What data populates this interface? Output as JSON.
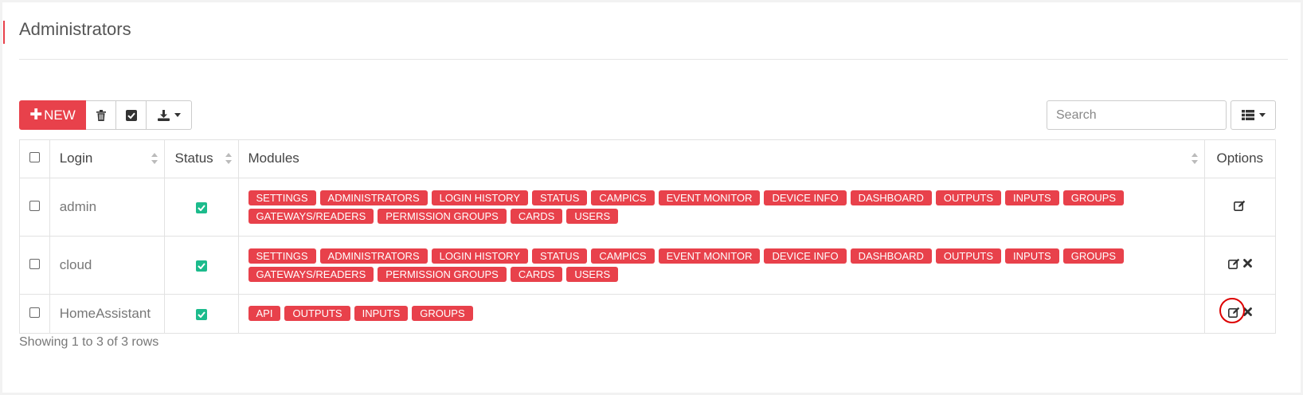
{
  "page": {
    "title": "Administrators"
  },
  "toolbar": {
    "new_label": "NEW",
    "search_placeholder": "Search"
  },
  "table": {
    "columns": [
      "Login",
      "Status",
      "Modules",
      "Options"
    ],
    "rows": [
      {
        "login": "admin",
        "status": "checked",
        "modules": [
          "SETTINGS",
          "ADMINISTRATORS",
          "LOGIN HISTORY",
          "STATUS",
          "CAMPICS",
          "EVENT MONITOR",
          "DEVICE INFO",
          "DASHBOARD",
          "OUTPUTS",
          "INPUTS",
          "GROUPS",
          "GATEWAYS/READERS",
          "PERMISSION GROUPS",
          "CARDS",
          "USERS"
        ],
        "options": [
          "edit-icon"
        ]
      },
      {
        "login": "cloud",
        "status": "checked",
        "modules": [
          "SETTINGS",
          "ADMINISTRATORS",
          "LOGIN HISTORY",
          "STATUS",
          "CAMPICS",
          "EVENT MONITOR",
          "DEVICE INFO",
          "DASHBOARD",
          "OUTPUTS",
          "INPUTS",
          "GROUPS",
          "GATEWAYS/READERS",
          "PERMISSION GROUPS",
          "CARDS",
          "USERS"
        ],
        "options": [
          "edit-icon",
          "delete-icon"
        ]
      },
      {
        "login": "HomeAssistant",
        "status": "checked",
        "modules": [
          "API",
          "OUTPUTS",
          "INPUTS",
          "GROUPS"
        ],
        "options": [
          "edit-icon",
          "delete-icon"
        ]
      }
    ]
  },
  "pagination": {
    "summary": "Showing 1 to 3 of 3 rows"
  },
  "colors": {
    "accent": "#e8414b",
    "status_ok": "#1cbb8c",
    "highlight_ring": "#dd0000"
  },
  "icons": [
    "plus-icon",
    "trash-icon",
    "check-square-icon",
    "download-icon",
    "caret-down-icon",
    "list-view-icon",
    "edit-icon",
    "delete-icon",
    "check-icon",
    "sort-icon"
  ]
}
